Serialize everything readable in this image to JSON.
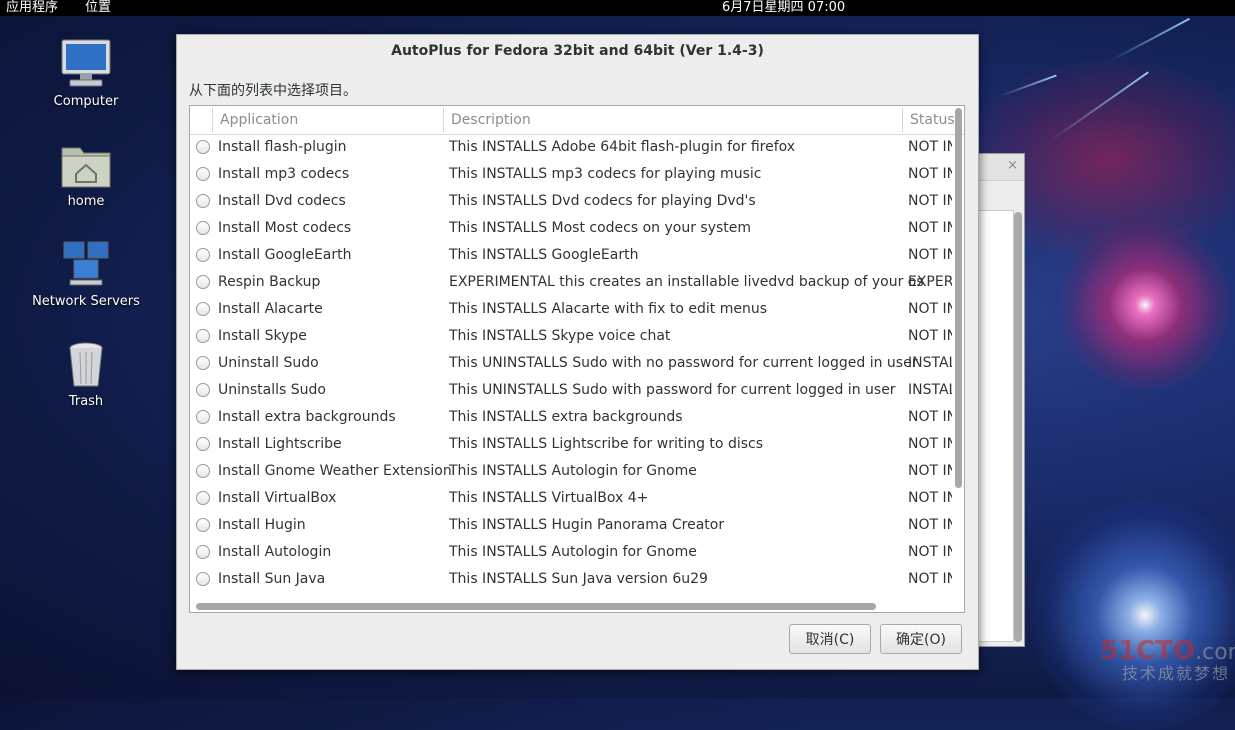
{
  "top_panel": {
    "applications_menu": "应用程序",
    "places_menu": "位置",
    "clock": "6月7日星期四  07:00"
  },
  "desktop_icons": [
    {
      "label": "Computer",
      "icon": "computer-icon"
    },
    {
      "label": "home",
      "icon": "home-folder-icon"
    },
    {
      "label": "Network Servers",
      "icon": "network-servers-icon"
    },
    {
      "label": "Trash",
      "icon": "trash-icon"
    }
  ],
  "dialog": {
    "title": "AutoPlus for Fedora 32bit and 64bit (Ver 1.4-3)",
    "prompt": "从下面的列表中选择项目。",
    "columns": {
      "application": "Application",
      "description": "Description",
      "status": "Status"
    },
    "rows": [
      {
        "app": "Install flash-plugin",
        "desc": "This INSTALLS Adobe 64bit flash-plugin for firefox",
        "status": "NOT INSTALLED"
      },
      {
        "app": "Install mp3 codecs",
        "desc": "This INSTALLS mp3 codecs for playing music",
        "status": "NOT INSTALLED"
      },
      {
        "app": "Install Dvd codecs",
        "desc": "This INSTALLS Dvd codecs for playing Dvd's",
        "status": "NOT INSTALLED"
      },
      {
        "app": "Install Most codecs",
        "desc": "This INSTALLS Most codecs on your system",
        "status": "NOT INSTALLED"
      },
      {
        "app": "Install GoogleEarth",
        "desc": "This INSTALLS GoogleEarth",
        "status": "NOT INSTALLED"
      },
      {
        "app": "Respin Backup",
        "desc": "EXPERIMENTAL this creates an installable livedvd backup of your os",
        "status": "EXPERIMENTAL"
      },
      {
        "app": "Install Alacarte",
        "desc": "This INSTALLS Alacarte with fix to edit menus",
        "status": "NOT INSTALLED"
      },
      {
        "app": "Install Skype",
        "desc": "This INSTALLS Skype voice chat",
        "status": "NOT INSTALLED"
      },
      {
        "app": "Uninstall Sudo",
        "desc": "This UNINSTALLS Sudo with no password for current logged in user",
        "status": "INSTALLED"
      },
      {
        "app": "Uninstalls Sudo",
        "desc": "This UNINSTALLS Sudo with password for current logged in user",
        "status": "INSTALLED"
      },
      {
        "app": "Install extra backgrounds",
        "desc": "This INSTALLS extra backgrounds",
        "status": "NOT INSTALLED"
      },
      {
        "app": "Install Lightscribe",
        "desc": "This INSTALLS Lightscribe for writing to discs",
        "status": "NOT INSTALLED"
      },
      {
        "app": "Install Gnome Weather Extension",
        "desc": "This INSTALLS Autologin for Gnome",
        "status": "NOT INSTALLED"
      },
      {
        "app": "Install VirtualBox",
        "desc": "This INSTALLS VirtualBox 4+",
        "status": "NOT INSTALLED"
      },
      {
        "app": "Install Hugin",
        "desc": "This INSTALLS Hugin Panorama Creator",
        "status": "NOT INSTALLED"
      },
      {
        "app": "Install Autologin",
        "desc": "This INSTALLS Autologin for Gnome",
        "status": "NOT INSTALLED"
      },
      {
        "app": "Install Sun Java",
        "desc": "This INSTALLS Sun Java version 6u29",
        "status": "NOT INSTALLED"
      }
    ],
    "cancel_label": "取消(C)",
    "ok_label": "确定(O)"
  },
  "background_window": {
    "close_glyph": "×"
  },
  "watermark": {
    "brand": "51CTO",
    "brand_suffix": ".com",
    "sub": "技术成就梦想"
  }
}
